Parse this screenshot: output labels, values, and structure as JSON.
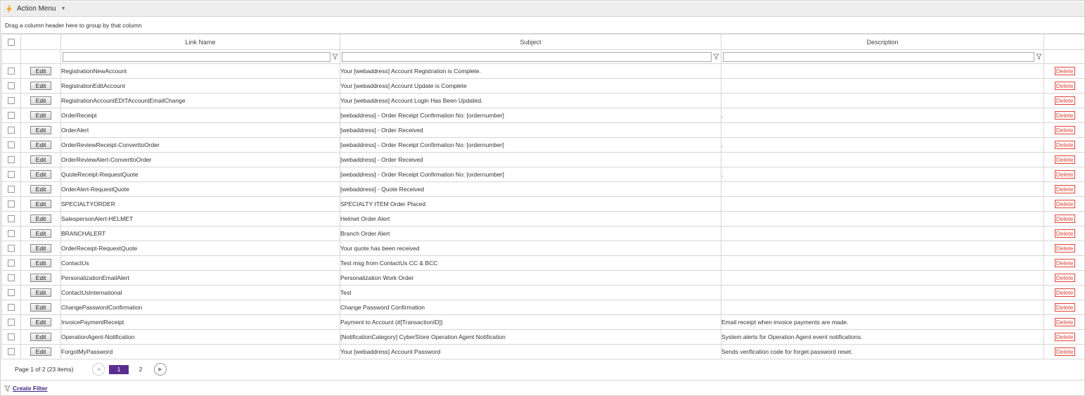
{
  "action_menu": {
    "label": "Action Menu",
    "icon": "lightning-icon",
    "accent": "#f5a623"
  },
  "group_hint": "Drag a column header here to group by that column",
  "columns": [
    "Link Name",
    "Subject",
    "Description"
  ],
  "edit_label": "Edit",
  "delete_label": "Delete",
  "rows": [
    {
      "link": "RegistrationNewAccount",
      "subject": "Your [webaddress] Account Registration is Complete.",
      "description": ""
    },
    {
      "link": "RegistrationEditAccount",
      "subject": "Your [webaddress] Account Update is Complete",
      "description": ""
    },
    {
      "link": "RegistrationAccountEDITAccountEmailChange",
      "subject": "Your [webaddress] Account Login Has Been Updated.",
      "description": ""
    },
    {
      "link": "OrderReceipt",
      "subject": "[webaddress] - Order Receipt Confirmation No: [ordernumber]",
      "description": "."
    },
    {
      "link": "OrderAlert",
      "subject": "[webaddress] - Order Received",
      "description": ""
    },
    {
      "link": "OrderReviewReceipt-ConverttoOrder",
      "subject": "[webaddress] - Order Receipt Confirmation No: [ordernumber]",
      "description": "."
    },
    {
      "link": "OrderReviewAlert-ConverttoOrder",
      "subject": "[webaddress] - Order Received",
      "description": ""
    },
    {
      "link": "QuoteReceipt-RequestQuote",
      "subject": "[webaddress] - Order Receipt Confirmation No: [ordernumber]",
      "description": "."
    },
    {
      "link": "OrderAlert-RequestQuote",
      "subject": "[webaddress] - Quote Received",
      "description": ""
    },
    {
      "link": "SPECIALTYORDER",
      "subject": "SPECIALTY ITEM Order Placed",
      "description": ""
    },
    {
      "link": "SalespersonAlert-HELMET",
      "subject": "Helmet Order Alert",
      "description": ""
    },
    {
      "link": "BRANCHALERT",
      "subject": "Branch Order Alert",
      "description": ""
    },
    {
      "link": "OrderReceipt-RequestQuote",
      "subject": "Your quote has been received",
      "description": ""
    },
    {
      "link": "ContactUs",
      "subject": "Test msg from ContactUs CC & BCC",
      "description": ""
    },
    {
      "link": "PersonalizationEmailAlert",
      "subject": "Personalization Work Order",
      "description": ""
    },
    {
      "link": "ContactUsInternational",
      "subject": "Test",
      "description": ""
    },
    {
      "link": "ChangePasswordConfirmation",
      "subject": "Change Password Confirmation",
      "description": ""
    },
    {
      "link": "InvoicePaymentReceipt",
      "subject": "Payment to Account (#[TransactionID])",
      "description": "Email receipt when invoice payments are made."
    },
    {
      "link": "OperationAgent-Notification",
      "subject": "[NotificationCategory] CyberStore Operation Agent Notification",
      "description": "System alerts for Operation Agent event notifications."
    },
    {
      "link": "ForgotMyPassword",
      "subject": "Your [webaddress] Account Password",
      "description": "Sends verification code for forget password reset."
    }
  ],
  "pager": {
    "info": "Page 1 of 2 (23 items)",
    "pages": [
      "1",
      "2"
    ],
    "current": "1"
  },
  "footer": {
    "create_filter": "Create Filter",
    "icon": "funnel-icon"
  },
  "colors": {
    "pager_active": "#5c2d91",
    "delete": "#e0453a",
    "border": "#d6d6d6"
  }
}
